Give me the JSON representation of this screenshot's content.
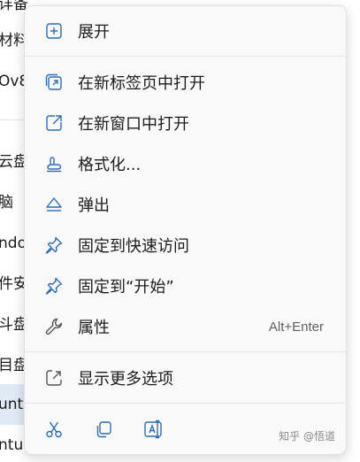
{
  "background_nav": {
    "items": [
      "详备",
      "材料",
      "Ov8",
      "云盘",
      "脑",
      "ndo",
      "件安",
      "斗盘",
      "目盘",
      "unt",
      "ntu"
    ]
  },
  "context_menu": {
    "expand_label": "展开",
    "open_new_tab_label": "在新标签页中打开",
    "open_new_window_label": "在新窗口中打开",
    "format_label": "格式化...",
    "eject_label": "弹出",
    "pin_quick_access_label": "固定到快速访问",
    "pin_start_label": "固定到“开始”",
    "properties_label": "属性",
    "properties_shortcut": "Alt+Enter",
    "show_more_label": "显示更多选项",
    "toolbar": [
      "cut-icon",
      "copy-icon",
      "rename-icon"
    ]
  },
  "watermark": {
    "text": "知乎 @悟道"
  },
  "colors": {
    "menu_bg": "#f9f9f9",
    "icon_accent": "#2a6db5",
    "selected_nav_bg": "#dfeaf5"
  }
}
